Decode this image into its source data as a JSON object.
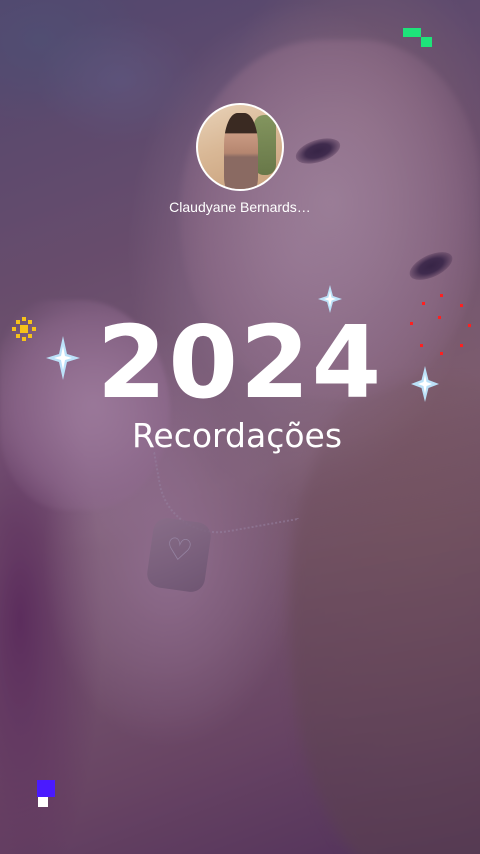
{
  "story": {
    "username": "Claudyane Bernards…",
    "year": "2024",
    "subtitle": "Recordações"
  },
  "icons": {
    "sparkles": [
      "sparkle-icon",
      "sparkle-icon",
      "sparkle-icon"
    ],
    "sun": "sun-icon",
    "red_dots": "dot-ring-icon",
    "pixels": [
      "pixel-green-icon",
      "pixel-blue-icon"
    ]
  },
  "colors": {
    "overlay": "#462d6e",
    "text": "#ffffff",
    "sparkle": "#bfe8ff",
    "sun": "#f6c21a",
    "red_dots": "#ff1f1f",
    "pixel_green": "#1ee37a",
    "pixel_blue": "#4a1aff"
  }
}
